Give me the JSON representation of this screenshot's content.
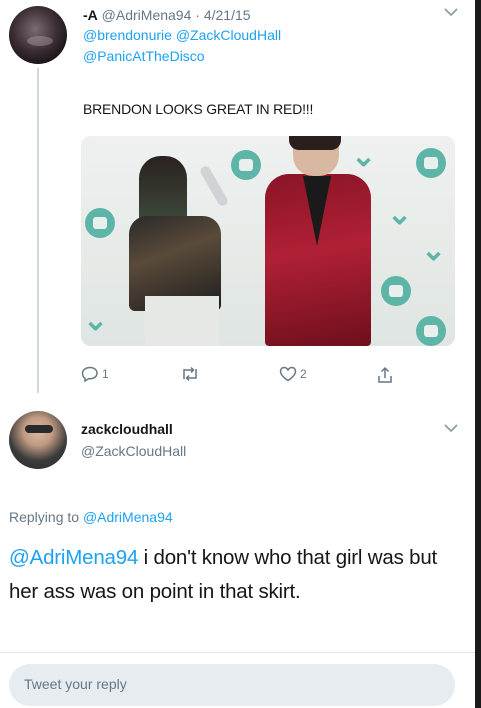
{
  "tweet1": {
    "name": "-A",
    "handle": "@AdriMena94",
    "separator": "·",
    "date": "4/21/15",
    "to_line1": "@brendonurie @ZackCloudHall",
    "to_line2": "@PanicAtTheDisco",
    "text": "BRENDON LOOKS GREAT IN RED!!!",
    "reply_count": "1",
    "retweet_count": "",
    "like_count": "2"
  },
  "tweet2": {
    "name": "zackcloudhall",
    "handle": "@ZackCloudHall",
    "replying_prefix": "Replying to",
    "replying_handle": "@AdriMena94",
    "mention": "@AdriMena94",
    "text": " i don't know who that girl was but her ass was on point in that skirt."
  },
  "compose": {
    "placeholder": "Tweet your reply"
  },
  "colors": {
    "accent": "#1da1f2",
    "muted": "#657786",
    "suit": "#b02035"
  },
  "icons": [
    "chevron-down-icon",
    "reply-icon",
    "retweet-icon",
    "like-icon",
    "share-icon"
  ]
}
